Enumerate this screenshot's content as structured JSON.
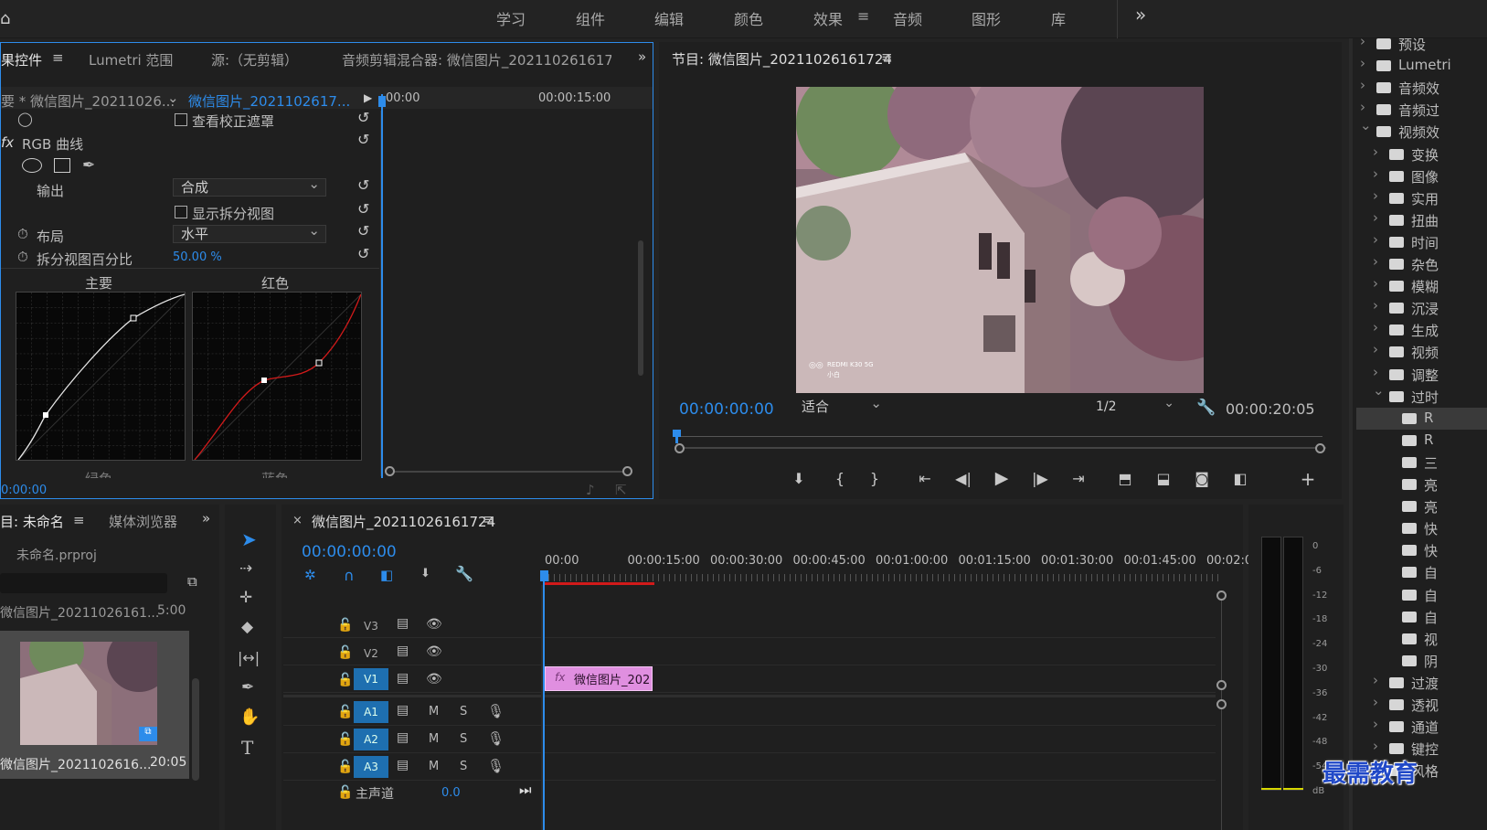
{
  "workspace": {
    "tabs": [
      "学习",
      "组件",
      "编辑",
      "颜色",
      "效果",
      "音频",
      "图形",
      "库"
    ],
    "active": "效果",
    "more": "»"
  },
  "effect_controls": {
    "tabs": [
      "果控件",
      "Lumetri 范围",
      "源:（无剪辑）",
      "音频剪辑混合器: 微信图片_2021102616172"
    ],
    "menu_icon": "≡",
    "source_label": "要 * 微信图片_20211026...",
    "clip_label": "微信图片_2021102617...",
    "time_start": "00:00",
    "time_mid": "00:00:15:00",
    "view_mask_label": "查看校正遮罩",
    "rgb_curves_label": "RGB 曲线",
    "fx_label": "fx",
    "output_label": "输出",
    "output_value": "合成",
    "show_split_label": "显示拆分视图",
    "layout_label": "布局",
    "layout_value": "水平",
    "split_pct_label": "拆分视图百分比",
    "split_pct_value": "50.00 %",
    "curve_main_label": "主要",
    "curve_red_label": "红色",
    "curve_green_label": "绿色",
    "curve_blue_label": "蓝色",
    "timecode": "0:00:00"
  },
  "program_monitor": {
    "title": "节目: 微信图片_20211026161724",
    "timecode": "00:00:00:00",
    "fit_value": "适合",
    "resolution": "1/2",
    "duration": "00:00:20:05",
    "watermark_line1": "REDMI K30 5G",
    "watermark_line2": "小白"
  },
  "project": {
    "tabs": [
      "目: 未命名",
      "媒体浏览器"
    ],
    "file": "未命名.prproj",
    "clip_name": "微信图片_20211026161...",
    "clip_dur": "5:00",
    "thumb_name": "微信图片_2021102616...",
    "thumb_dur": "20:05"
  },
  "timeline": {
    "title": "微信图片_20211026161724",
    "timecode": "00:00:00:00",
    "ruler": [
      "00:00",
      "00:00:15:00",
      "00:00:30:00",
      "00:00:45:00",
      "00:01:00:00",
      "00:01:15:00",
      "00:01:30:00",
      "00:01:45:00",
      "00:02:0"
    ],
    "video_tracks": [
      "V3",
      "V2",
      "V1"
    ],
    "audio_tracks": [
      "A1",
      "A2",
      "A3"
    ],
    "clip_label": "微信图片_202",
    "clip_fx": "fx",
    "master_label": "主声道",
    "master_value": "0.0",
    "m_label": "M",
    "s_label": "S"
  },
  "meter": {
    "scale": [
      "0",
      "-6",
      "-12",
      "-18",
      "-24",
      "-30",
      "-36",
      "-42",
      "-48",
      "-54",
      "dB"
    ]
  },
  "effects_tree": {
    "items": [
      {
        "label": "预设",
        "expanded": false,
        "indent": 0
      },
      {
        "label": "Lumetri",
        "expanded": false,
        "indent": 0
      },
      {
        "label": "音频效",
        "expanded": false,
        "indent": 0
      },
      {
        "label": "音频过",
        "expanded": false,
        "indent": 0
      },
      {
        "label": "视频效",
        "expanded": true,
        "indent": 0
      },
      {
        "label": "变换",
        "expanded": false,
        "indent": 1
      },
      {
        "label": "图像",
        "expanded": false,
        "indent": 1
      },
      {
        "label": "实用",
        "expanded": false,
        "indent": 1
      },
      {
        "label": "扭曲",
        "expanded": false,
        "indent": 1
      },
      {
        "label": "时间",
        "expanded": false,
        "indent": 1
      },
      {
        "label": "杂色",
        "expanded": false,
        "indent": 1
      },
      {
        "label": "模糊",
        "expanded": false,
        "indent": 1
      },
      {
        "label": "沉浸",
        "expanded": false,
        "indent": 1
      },
      {
        "label": "生成",
        "expanded": false,
        "indent": 1
      },
      {
        "label": "视频",
        "expanded": false,
        "indent": 1
      },
      {
        "label": "调整",
        "expanded": false,
        "indent": 1
      },
      {
        "label": "过时",
        "expanded": true,
        "indent": 1
      },
      {
        "label": "R",
        "expanded": false,
        "indent": 2
      },
      {
        "label": "R",
        "expanded": false,
        "indent": 2
      },
      {
        "label": "三",
        "expanded": false,
        "indent": 2
      },
      {
        "label": "亮",
        "expanded": false,
        "indent": 2
      },
      {
        "label": "亮",
        "expanded": false,
        "indent": 2
      },
      {
        "label": "快",
        "expanded": false,
        "indent": 2
      },
      {
        "label": "快",
        "expanded": false,
        "indent": 2
      },
      {
        "label": "自",
        "expanded": false,
        "indent": 2
      },
      {
        "label": "自",
        "expanded": false,
        "indent": 2
      },
      {
        "label": "自",
        "expanded": false,
        "indent": 2
      },
      {
        "label": "视",
        "expanded": false,
        "indent": 2
      },
      {
        "label": "阴",
        "expanded": false,
        "indent": 2
      },
      {
        "label": "过渡",
        "expanded": false,
        "indent": 1
      },
      {
        "label": "透视",
        "expanded": false,
        "indent": 1
      },
      {
        "label": "通道",
        "expanded": false,
        "indent": 1
      },
      {
        "label": "键控",
        "expanded": false,
        "indent": 1
      },
      {
        "label": "风格",
        "expanded": false,
        "indent": 1
      }
    ]
  },
  "watermark_text": "最需教育",
  "colors": {
    "accent": "#2d8ceb",
    "clip": "#e08fe0",
    "red_curve": "#d11a1a",
    "track_blue": "#1e6fb0"
  }
}
